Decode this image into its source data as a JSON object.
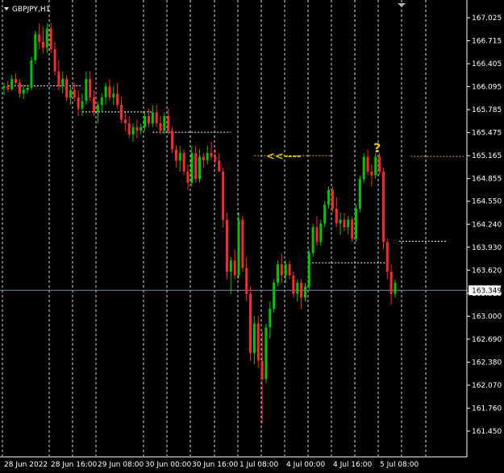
{
  "window": {
    "symbol_title": "GBPJPY,H1"
  },
  "colors": {
    "background": "#000000",
    "bull": "#00c800",
    "bear": "#ff2828",
    "grid": "#ffffff",
    "support_line": "#ffffff",
    "resistance_line": "#e0c000",
    "current_price_line": "#7a8fa8",
    "price_tag_bg": "#ffffff",
    "price_tag_text": "#000000"
  },
  "chart_data": {
    "type": "candlestick",
    "symbol": "GBPJPY",
    "timeframe": "H1",
    "grid": true,
    "ylim": [
      161.45,
      167.18
    ],
    "y_ticks": [
      "167.025",
      "166.715",
      "166.405",
      "166.095",
      "165.785",
      "165.475",
      "165.165",
      "164.855",
      "164.550",
      "164.240",
      "163.930",
      "163.620",
      "163.310",
      "163.000",
      "162.690",
      "162.380",
      "162.070",
      "161.760",
      "161.450"
    ],
    "x_tick_labels": [
      "28 Jun 2022",
      "28 Jun 16:00",
      "29 Jun 08:00",
      "30 Jun 00:00",
      "30 Jun 16:00",
      "1 Jul 08:00",
      "4 Jul 00:00",
      "4 Jul 16:00",
      "5 Jul 08:00"
    ],
    "current_price": "163.349",
    "annotations": {
      "arrow_text": "<<----",
      "question_mark": "?"
    },
    "levels": [
      {
        "kind": "support",
        "price": 166.105,
        "from_bar": 1,
        "to_bar": 20
      },
      {
        "kind": "support",
        "price": 165.755,
        "from_bar": 20,
        "to_bar": 38
      },
      {
        "kind": "support",
        "price": 165.48,
        "from_bar": 38,
        "to_bar": 58
      },
      {
        "kind": "resistance",
        "price": 165.165,
        "from_bar": 64,
        "to_bar": 84
      },
      {
        "kind": "support",
        "price": 163.72,
        "from_bar": 78,
        "to_bar": 98
      },
      {
        "kind": "resistance",
        "price": 165.155,
        "from_bar": 104,
        "to_bar": 132
      },
      {
        "kind": "support",
        "price": 164.01,
        "from_bar": 101,
        "to_bar": 113
      }
    ],
    "candles": [
      [
        166.08,
        166.15,
        165.98,
        166.1
      ],
      [
        166.1,
        166.18,
        166.02,
        166.06
      ],
      [
        166.06,
        166.25,
        166.04,
        166.2
      ],
      [
        166.2,
        166.28,
        166.1,
        166.15
      ],
      [
        166.15,
        166.2,
        165.95,
        166.0
      ],
      [
        166.0,
        166.12,
        165.93,
        166.05
      ],
      [
        166.05,
        166.12,
        166.0,
        166.08
      ],
      [
        166.08,
        166.5,
        166.05,
        166.45
      ],
      [
        166.45,
        166.85,
        166.4,
        166.8
      ],
      [
        166.8,
        166.95,
        166.6,
        166.7
      ],
      [
        166.7,
        166.9,
        166.55,
        166.62
      ],
      [
        166.62,
        166.95,
        166.55,
        166.88
      ],
      [
        166.88,
        166.95,
        166.55,
        166.6
      ],
      [
        166.6,
        166.7,
        166.25,
        166.3
      ],
      [
        166.3,
        166.45,
        166.05,
        166.1
      ],
      [
        166.1,
        166.3,
        166.0,
        166.2
      ],
      [
        166.2,
        166.25,
        165.9,
        165.95
      ],
      [
        165.95,
        166.1,
        165.85,
        166.05
      ],
      [
        166.05,
        166.15,
        165.9,
        165.95
      ],
      [
        165.95,
        166.05,
        165.7,
        165.8
      ],
      [
        165.8,
        166.0,
        165.7,
        165.9
      ],
      [
        165.9,
        166.3,
        165.85,
        166.2
      ],
      [
        166.2,
        166.3,
        165.9,
        165.95
      ],
      [
        165.95,
        166.05,
        165.7,
        165.75
      ],
      [
        165.75,
        165.9,
        165.6,
        165.85
      ],
      [
        165.85,
        166.0,
        165.75,
        165.95
      ],
      [
        165.95,
        166.15,
        165.85,
        166.1
      ],
      [
        166.1,
        166.2,
        165.9,
        165.95
      ],
      [
        165.95,
        166.1,
        165.85,
        166.0
      ],
      [
        166.0,
        166.15,
        165.8,
        165.85
      ],
      [
        165.85,
        165.95,
        165.6,
        165.65
      ],
      [
        165.65,
        165.75,
        165.5,
        165.6
      ],
      [
        165.6,
        165.7,
        165.4,
        165.45
      ],
      [
        165.45,
        165.6,
        165.35,
        165.55
      ],
      [
        165.55,
        165.65,
        165.4,
        165.5
      ],
      [
        165.5,
        165.6,
        165.45,
        165.55
      ],
      [
        165.55,
        165.75,
        165.5,
        165.7
      ],
      [
        165.7,
        165.8,
        165.55,
        165.6
      ],
      [
        165.6,
        165.85,
        165.55,
        165.75
      ],
      [
        165.75,
        165.85,
        165.55,
        165.6
      ],
      [
        165.6,
        165.7,
        165.45,
        165.5
      ],
      [
        165.5,
        165.75,
        165.45,
        165.7
      ],
      [
        165.7,
        165.8,
        165.45,
        165.5
      ],
      [
        165.5,
        165.55,
        165.2,
        165.25
      ],
      [
        165.25,
        165.3,
        165.0,
        165.1
      ],
      [
        165.1,
        165.3,
        164.95,
        165.2
      ],
      [
        165.2,
        165.25,
        164.9,
        164.95
      ],
      [
        164.95,
        165.05,
        164.7,
        164.8
      ],
      [
        164.8,
        165.3,
        164.75,
        165.2
      ],
      [
        165.2,
        165.3,
        164.8,
        164.85
      ],
      [
        164.85,
        165.25,
        164.8,
        165.15
      ],
      [
        165.15,
        165.2,
        165.0,
        165.1
      ],
      [
        165.1,
        165.3,
        165.05,
        165.2
      ],
      [
        165.2,
        165.35,
        165.1,
        165.15
      ],
      [
        165.15,
        165.25,
        165.05,
        165.1
      ],
      [
        165.1,
        165.2,
        164.95,
        164.95
      ],
      [
        164.95,
        165.0,
        164.2,
        164.3
      ],
      [
        164.3,
        164.4,
        163.5,
        163.6
      ],
      [
        163.6,
        163.8,
        163.3,
        163.75
      ],
      [
        163.75,
        163.9,
        163.5,
        163.55
      ],
      [
        163.55,
        164.4,
        163.5,
        164.3
      ],
      [
        164.3,
        164.35,
        163.6,
        163.65
      ],
      [
        163.65,
        163.8,
        163.2,
        163.3
      ],
      [
        163.3,
        163.4,
        162.4,
        162.5
      ],
      [
        162.5,
        163.0,
        162.35,
        162.9
      ],
      [
        162.9,
        163.0,
        162.3,
        162.4
      ],
      [
        162.4,
        162.8,
        161.55,
        162.15
      ],
      [
        162.15,
        162.9,
        162.1,
        162.85
      ],
      [
        162.85,
        163.2,
        162.7,
        163.1
      ],
      [
        163.1,
        163.5,
        163.05,
        163.45
      ],
      [
        163.45,
        163.75,
        163.4,
        163.7
      ],
      [
        163.7,
        163.85,
        163.45,
        163.55
      ],
      [
        163.55,
        163.75,
        163.45,
        163.7
      ],
      [
        163.7,
        163.75,
        163.5,
        163.55
      ],
      [
        163.55,
        163.6,
        163.25,
        163.3
      ],
      [
        163.3,
        163.5,
        163.2,
        163.45
      ],
      [
        163.45,
        163.5,
        163.1,
        163.25
      ],
      [
        163.25,
        163.45,
        163.2,
        163.4
      ],
      [
        163.4,
        163.9,
        163.35,
        163.85
      ],
      [
        163.85,
        164.25,
        163.8,
        164.2
      ],
      [
        164.2,
        164.35,
        163.95,
        164.0
      ],
      [
        164.0,
        164.3,
        163.95,
        164.25
      ],
      [
        164.25,
        164.55,
        164.2,
        164.5
      ],
      [
        164.5,
        164.75,
        164.45,
        164.7
      ],
      [
        164.7,
        164.75,
        164.4,
        164.45
      ],
      [
        164.45,
        164.6,
        164.2,
        164.25
      ],
      [
        164.25,
        164.4,
        164.1,
        164.3
      ],
      [
        164.3,
        164.4,
        164.15,
        164.2
      ],
      [
        164.2,
        164.35,
        164.1,
        164.3
      ],
      [
        164.3,
        164.35,
        164.0,
        164.05
      ],
      [
        164.05,
        164.5,
        164.0,
        164.45
      ],
      [
        164.45,
        164.9,
        164.4,
        164.85
      ],
      [
        164.85,
        165.2,
        164.8,
        165.15
      ],
      [
        165.15,
        165.25,
        164.9,
        164.95
      ],
      [
        164.95,
        165.05,
        164.75,
        164.9
      ],
      [
        164.9,
        165.2,
        164.85,
        165.15
      ],
      [
        165.15,
        165.2,
        164.9,
        164.95
      ],
      [
        164.95,
        165.0,
        163.9,
        164.0
      ],
      [
        164.0,
        164.05,
        163.5,
        163.6
      ],
      [
        163.6,
        163.7,
        163.15,
        163.3
      ],
      [
        163.3,
        163.5,
        163.25,
        163.45
      ]
    ]
  }
}
